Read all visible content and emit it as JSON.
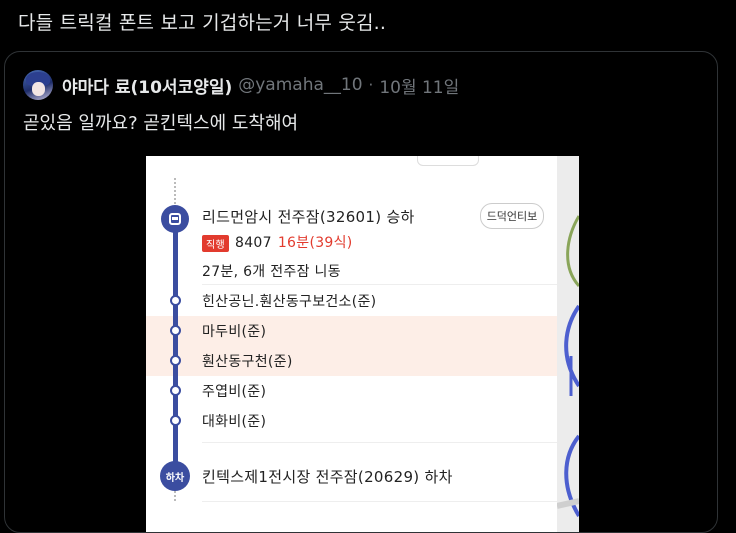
{
  "tweet": {
    "text": "다들 트릭컬 폰트 보고 기겁하는거 너무 웃김.."
  },
  "quoted_post": {
    "author_name": "야마다 료(10서코양일)",
    "author_handle": "@yamaha__10",
    "separator": "·",
    "date": "10월 11일",
    "text": "곧있음 일까요? 곧킨텍스에 도착해여"
  },
  "screenshot": {
    "board_stop": "리드먼암시 전주잠(32601) 승하",
    "board_button": "드덕언티보",
    "route_badge": "직행",
    "bus_number": "8407",
    "eta": "16분(39식)",
    "summary": "27분, 6개 전주잠 니동",
    "stops": [
      "힌산공닌.훤산동구보건소(준)",
      "마두비(준)",
      "훤산동구천(준)",
      "주엽비(준)",
      "대화비(준)"
    ],
    "exit_label": "하차",
    "exit_stop": "킨텍스제1전시장 전주잠(20629) 하차",
    "accent_color": "#3b4da0",
    "highlight_color": "#fdeee7"
  }
}
